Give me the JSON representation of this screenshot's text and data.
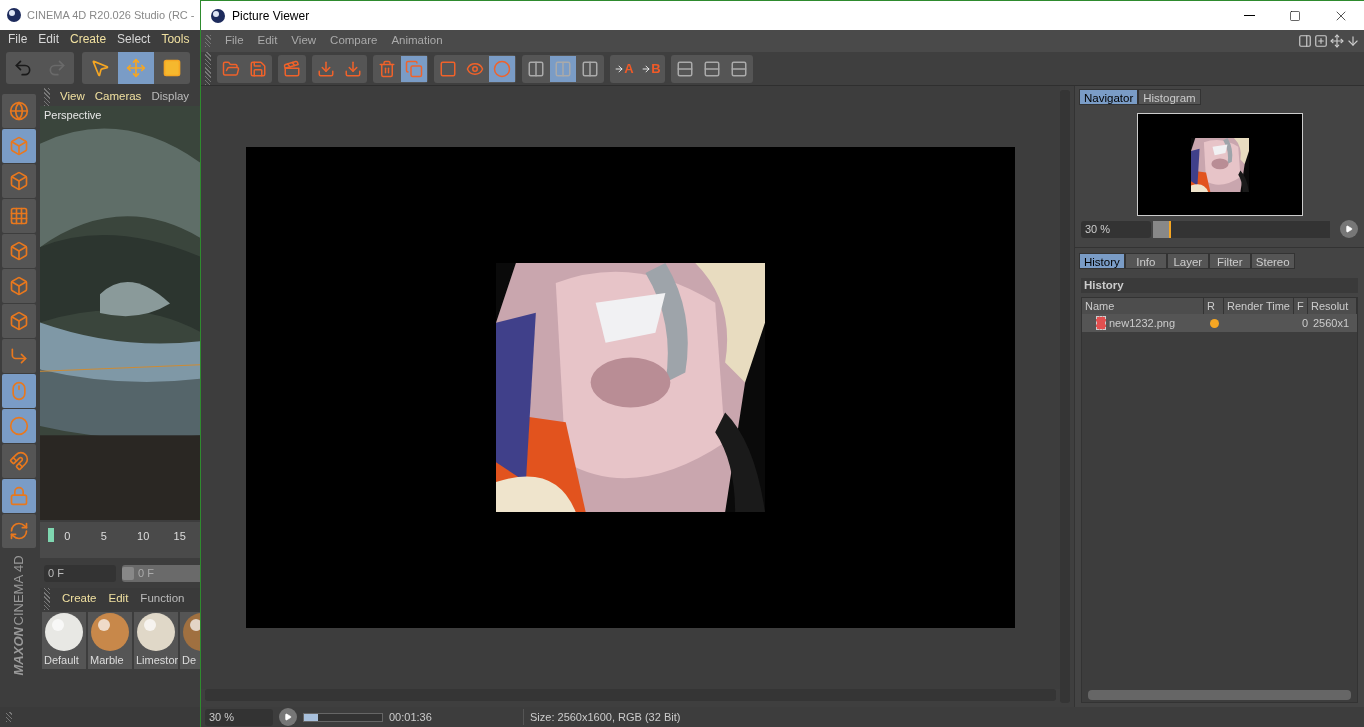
{
  "background_app": {
    "title": "CINEMA 4D R20.026 Studio (RC -",
    "menu": [
      {
        "label": "File",
        "highlight": false
      },
      {
        "label": "Edit",
        "highlight": false
      },
      {
        "label": "Create",
        "highlight": true
      },
      {
        "label": "Select",
        "highlight": false
      },
      {
        "label": "Tools",
        "highlight": true
      }
    ],
    "tools": [
      {
        "kind": "undo",
        "selected": false,
        "disabled": false
      },
      {
        "kind": "redo",
        "selected": false,
        "disabled": true
      },
      {
        "kind": "select",
        "selected": false,
        "disabled": false
      },
      {
        "kind": "move",
        "selected": true,
        "disabled": false
      },
      {
        "kind": "scale",
        "selected": false,
        "disabled": false
      }
    ],
    "side_tools": [
      {
        "kind": "globe",
        "selected": false
      },
      {
        "kind": "cube",
        "selected": true
      },
      {
        "kind": "checker",
        "selected": false
      },
      {
        "kind": "grid",
        "selected": false
      },
      {
        "kind": "points",
        "selected": false
      },
      {
        "kind": "edges",
        "selected": false
      },
      {
        "kind": "polygons",
        "selected": false
      },
      {
        "kind": "axis",
        "selected": false
      },
      {
        "kind": "mouse",
        "selected": true
      },
      {
        "kind": "snap",
        "selected": true
      },
      {
        "kind": "magnet",
        "selected": false
      },
      {
        "kind": "grid-lock",
        "selected": true
      },
      {
        "kind": "grid-refresh",
        "selected": false
      }
    ],
    "viewport_menu": [
      "View",
      "Cameras",
      "Display"
    ],
    "viewport_label": "Perspective",
    "timeline_ticks": [
      "0",
      "5",
      "10",
      "15"
    ],
    "frame_field": "0 F",
    "frame_slider": {
      "value": "0 F",
      "level": 0
    },
    "material_menu": [
      "Create",
      "Edit",
      "Function"
    ],
    "materials": [
      {
        "name": "Default",
        "color": "#e8e8e4"
      },
      {
        "name": "Marble",
        "color": "#c8884a"
      },
      {
        "name": "Limestor",
        "color": "#e0d8c8"
      },
      {
        "name": "De",
        "color": "#a07040"
      }
    ],
    "brand": [
      "MAXON",
      "CINEMA 4D"
    ]
  },
  "viewer": {
    "title": "Picture Viewer",
    "menu": [
      "File",
      "Edit",
      "View",
      "Compare",
      "Animation"
    ],
    "toolbar": [
      [
        {
          "kind": "open",
          "selected": false
        },
        {
          "kind": "save",
          "selected": false
        }
      ],
      [
        {
          "kind": "clapper",
          "selected": false
        }
      ],
      [
        {
          "kind": "grid-down",
          "selected": false
        },
        {
          "kind": "circle-down",
          "selected": false
        }
      ],
      [
        {
          "kind": "delete",
          "selected": false
        },
        {
          "kind": "layers",
          "selected": true
        }
      ],
      [
        {
          "kind": "frame",
          "selected": false
        },
        {
          "kind": "frame-eye",
          "selected": false
        },
        {
          "kind": "channels",
          "selected": true
        }
      ],
      [
        {
          "kind": "ab",
          "selected": false
        },
        {
          "kind": "ab-split",
          "selected": true
        },
        {
          "kind": "ab-dim",
          "selected": false
        }
      ],
      [
        {
          "kind": "to-a",
          "selected": false,
          "label": "A"
        },
        {
          "kind": "to-b",
          "selected": false,
          "label": "B"
        }
      ],
      [
        {
          "kind": "compare",
          "selected": false
        },
        {
          "kind": "compare",
          "selected": false
        },
        {
          "kind": "compare",
          "selected": false
        }
      ]
    ],
    "side_panel": {
      "tabs": [
        {
          "label": "Navigator",
          "selected": true
        },
        {
          "label": "Histogram",
          "selected": false
        }
      ],
      "zoom": "30 %",
      "zoom_slider": {
        "level": 0.1
      },
      "info_tabs": [
        {
          "label": "History",
          "selected": true
        },
        {
          "label": "Info",
          "selected": false
        },
        {
          "label": "Layer",
          "selected": false
        },
        {
          "label": "Filter",
          "selected": false
        },
        {
          "label": "Stereo",
          "selected": false
        }
      ],
      "section": "History",
      "columns": [
        "Name",
        "R",
        "Render Time",
        "F",
        "Resolut"
      ],
      "rows": [
        {
          "name": "new1232.png",
          "color": "#f5a623",
          "frame": "0",
          "resolution": "2560x1",
          "selected": true
        }
      ]
    },
    "status": {
      "zoom": "30 %",
      "progress": {
        "level": 0.18
      },
      "time": "00:01:36",
      "size": "Size: 2560x1600, RGB (32 Bit)"
    }
  }
}
